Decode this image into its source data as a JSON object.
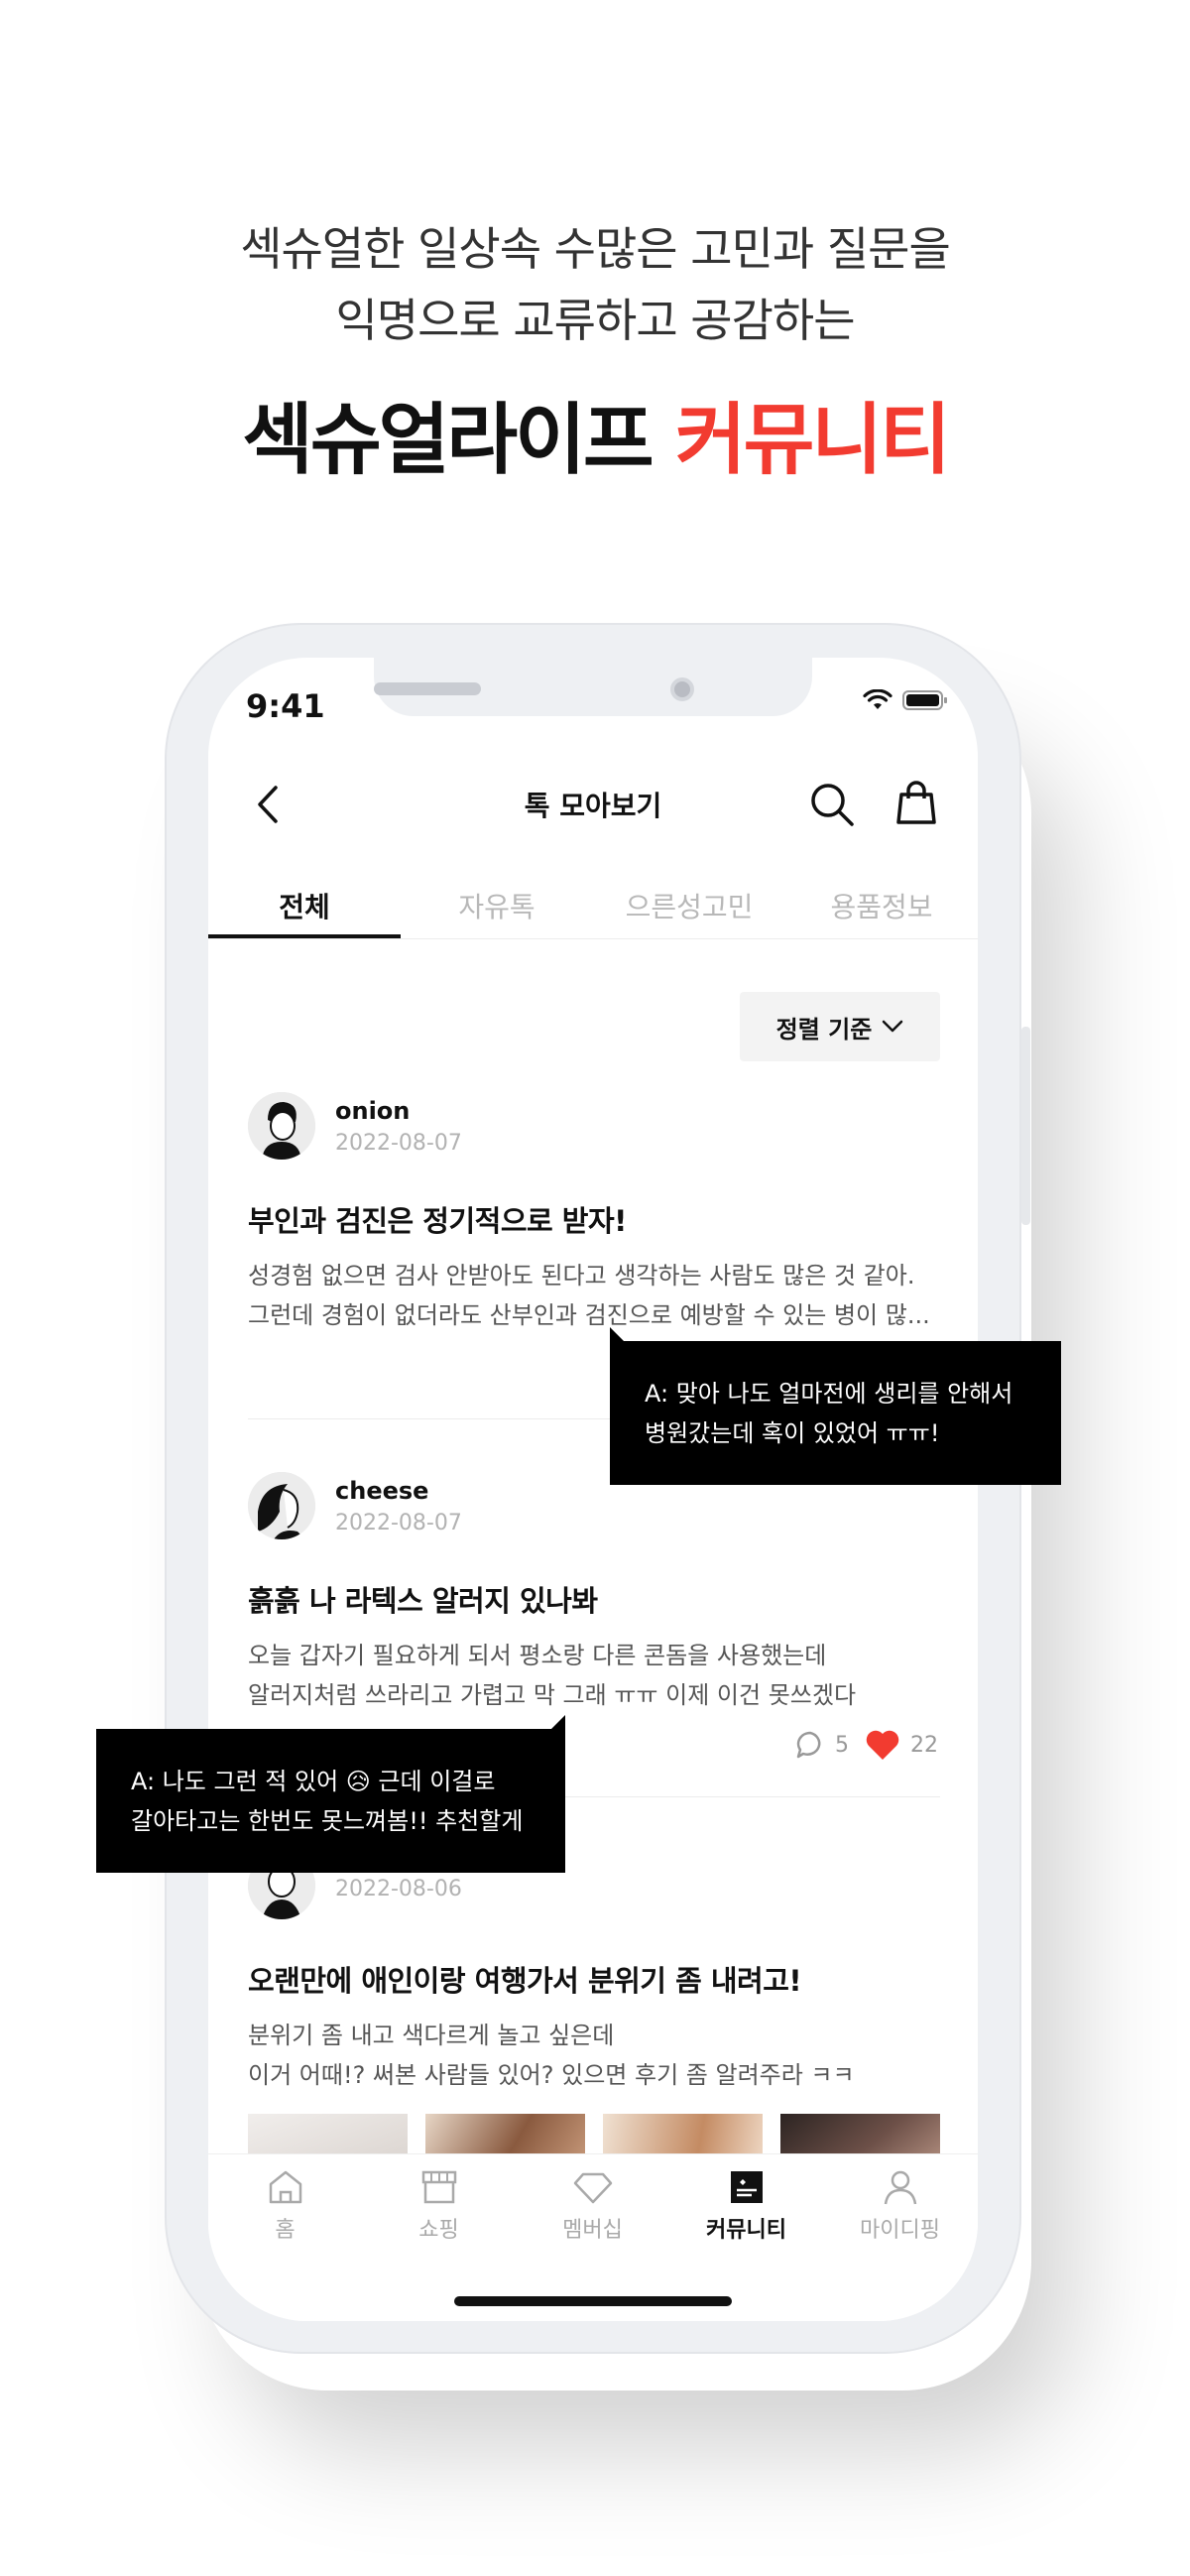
{
  "headline": {
    "line1": "섹슈얼한 일상속 수많은 고민과 질문을",
    "line2": "익명으로 교류하고 공감하는",
    "title_dark": "섹슈얼라이프 ",
    "title_accent": "커뮤니티"
  },
  "status_bar": {
    "time": "9:41"
  },
  "nav": {
    "title": "톡 모아보기",
    "icons": [
      "back-chevron-icon",
      "search-icon",
      "shopping-bag-icon"
    ]
  },
  "tabs": [
    {
      "label": "전체",
      "active": true
    },
    {
      "label": "자유톡",
      "active": false
    },
    {
      "label": "으른성고민",
      "active": false
    },
    {
      "label": "용품정보",
      "active": false
    }
  ],
  "sort": {
    "label": "정렬 기준"
  },
  "posts": [
    {
      "author": "onion",
      "date": "2022-08-07",
      "title": "부인과 검진은 정기적으로 받자!",
      "body_line1": "성경험 없으면 검사 안받아도 된다고 생각하는 사람도 많은 것 같아.",
      "body_line2": "그런데 경험이 없더라도 산부인과 검진으로 예방할 수 있는 병이 많..."
    },
    {
      "author": "cheese",
      "date": "2022-08-07",
      "title": "흙흙 나 라텍스 알러지 있나봐",
      "body_line1": "오늘 갑자기 필요하게 되서 평소랑 다른 콘돔을 사용했는데",
      "body_line2": "알러지처럼 쓰라리고 가렵고 막 그래 ㅠㅠ 이제 이건 못쓰겠다",
      "comments": "5",
      "likes": "22"
    },
    {
      "date": "2022-08-06",
      "title": "오랜만에 애인이랑 여행가서 분위기 좀 내려고!",
      "body_line1": "분위기 좀 내고 색다르게 놀고 싶은데",
      "body_line2": "이거 어때!? 써본 사람들 있어? 있으면 후기 좀 알려주라 ㅋㅋ"
    }
  ],
  "bubbles": {
    "reply1": "A: 맞아 나도 얼마전에 생리를 안해서\n병원갔는데 혹이 있었어 ㅠㅠ!",
    "reply2": "A: 나도 그런 적 있어 😥 근데 이걸로\n갈아타고는 한번도 못느껴봄!! 추천할게"
  },
  "bottom_nav": [
    {
      "label": "홈",
      "icon": "home-icon",
      "active": false
    },
    {
      "label": "쇼핑",
      "icon": "store-icon",
      "active": false
    },
    {
      "label": "멤버십",
      "icon": "diamond-icon",
      "active": false
    },
    {
      "label": "커뮤니티",
      "icon": "community-board-icon",
      "active": true
    },
    {
      "label": "마이디핑",
      "icon": "person-icon",
      "active": false
    }
  ],
  "colors": {
    "accent": "#f23b30",
    "text": "#111111",
    "muted": "#b2b2b2",
    "like": "#f23b30"
  }
}
